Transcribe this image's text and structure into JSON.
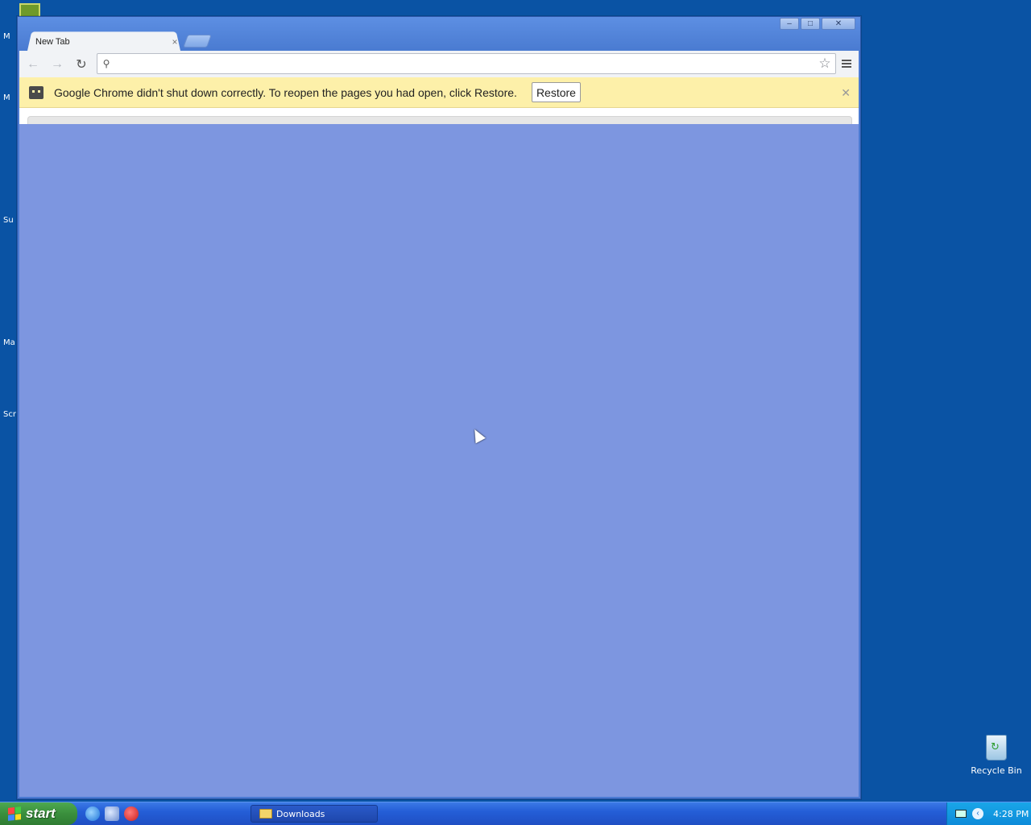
{
  "desktop": {
    "fragments": [
      "M",
      "M",
      "Su",
      "Ma",
      "Scr"
    ],
    "recycle_bin_label": "Recycle Bin"
  },
  "browser": {
    "tab_title": "New Tab",
    "tab_close": "×",
    "omnibox_value": "",
    "infobar_message": "Google Chrome didn't shut down correctly. To reopen the pages you had open, click Restore.",
    "restore_label": "Restore",
    "infobar_close": "✕",
    "content_bg": "#7d96e0"
  },
  "window_controls": {
    "minimize": "–",
    "maximize": "□",
    "close": "✕"
  },
  "taskbar": {
    "start_label": "start",
    "task_label": "Downloads",
    "clock": "4:28 PM"
  }
}
